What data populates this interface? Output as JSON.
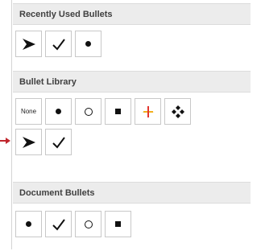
{
  "sections": {
    "recent": {
      "title": "Recently Used Bullets"
    },
    "library": {
      "title": "Bullet Library",
      "none_label": "None"
    },
    "document": {
      "title": "Document Bullets"
    }
  },
  "icons": {
    "recent": [
      "arrowhead-bullet-icon",
      "checkmark-bullet-icon",
      "filled-dot-bullet-icon"
    ],
    "library": [
      "none-bullet",
      "filled-dot-bullet-icon",
      "hollow-circle-bullet-icon",
      "filled-square-bullet-icon",
      "multicolor-star-bullet-icon",
      "diamond-cluster-bullet-icon",
      "arrowhead-bullet-icon",
      "checkmark-bullet-icon"
    ],
    "document": [
      "filled-dot-bullet-icon",
      "checkmark-bullet-icon",
      "hollow-circle-bullet-icon",
      "filled-square-bullet-icon"
    ]
  },
  "colors": {
    "header_bg": "#ececec",
    "pointer_arrow": "#c0262d",
    "star_colors": [
      "#e3362f",
      "#2f5fd0",
      "#f2b01e",
      "#2ea44f"
    ]
  }
}
